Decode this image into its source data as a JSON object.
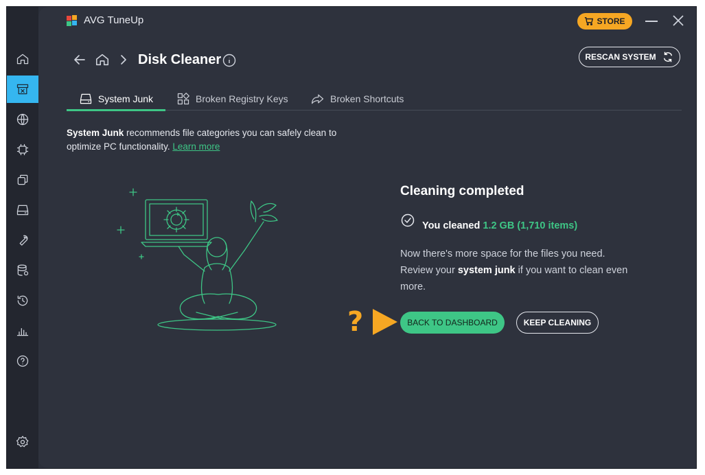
{
  "app": {
    "title": "AVG TuneUp",
    "store_label": "STORE"
  },
  "colors": {
    "accent_green": "#3ec686",
    "accent_blue": "#35b6f0",
    "store_orange": "#f6a723",
    "panel": "#2e323d",
    "sidebar": "#23262f"
  },
  "sidebar": {
    "items": [
      {
        "icon": "home-icon"
      },
      {
        "icon": "disk-cleaner-icon",
        "active": true
      },
      {
        "icon": "browser-globe-icon"
      },
      {
        "icon": "processor-icon"
      },
      {
        "icon": "apps-icon"
      },
      {
        "icon": "drive-icon"
      },
      {
        "icon": "wrench-icon"
      },
      {
        "icon": "database-icon"
      },
      {
        "icon": "history-icon"
      },
      {
        "icon": "reports-chart-icon"
      },
      {
        "icon": "help-icon"
      },
      {
        "icon": "settings-gear-icon"
      }
    ]
  },
  "header": {
    "page_title": "Disk Cleaner",
    "rescan_label": "RESCAN SYSTEM"
  },
  "tabs": [
    {
      "label": "System Junk",
      "icon": "drive-icon",
      "active": true
    },
    {
      "label": "Broken Registry Keys",
      "icon": "registry-blocks-icon"
    },
    {
      "label": "Broken Shortcuts",
      "icon": "shortcut-arrow-icon"
    }
  ],
  "description": {
    "bold": "System Junk",
    "text": " recommends file categories you can safely clean to optimize PC functionality. ",
    "link": "Learn more"
  },
  "result": {
    "title": "Cleaning completed",
    "cleaned_prefix": "You cleaned ",
    "cleaned_amount": "1.2 GB (1,710 items)",
    "body_before": "Now there's more space for the files you need. Review your ",
    "body_bold": "system junk",
    "body_after": " if you want to clean even more."
  },
  "actions": {
    "primary": "BACK TO DASHBOARD",
    "secondary": "KEEP CLEANING"
  },
  "annotation": {
    "question_mark": "?"
  }
}
